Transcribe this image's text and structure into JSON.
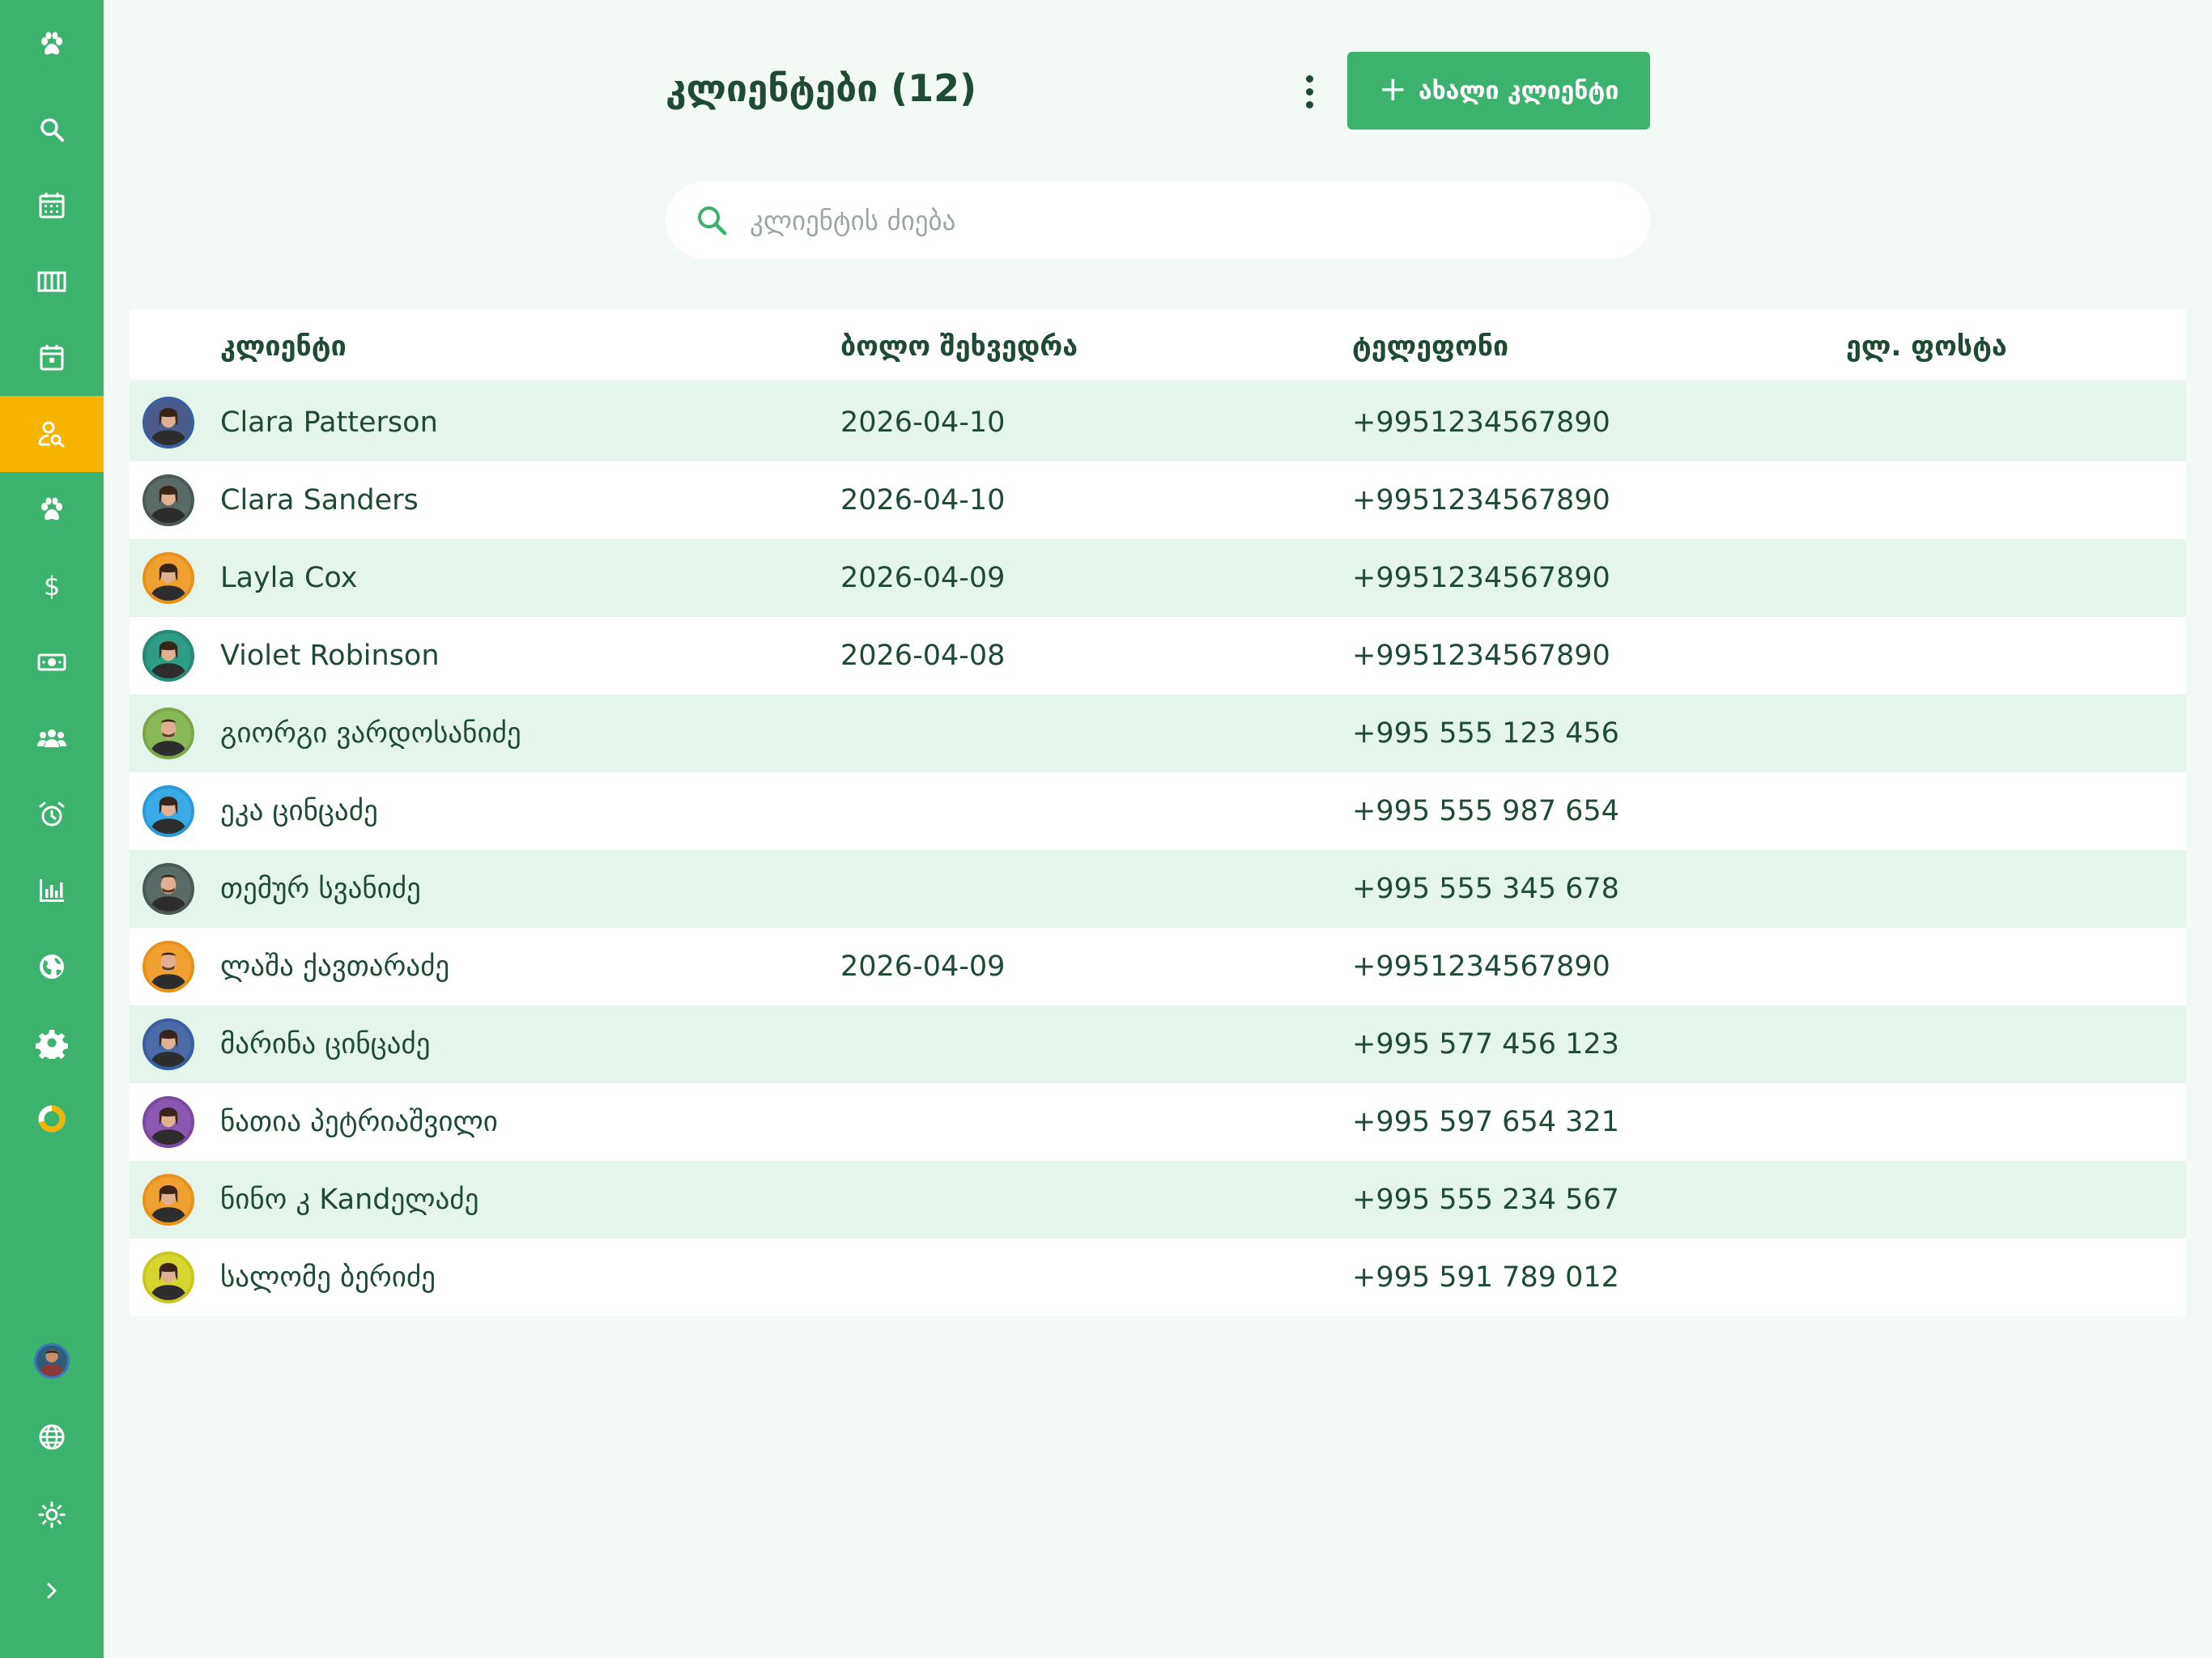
{
  "sidebar": {
    "items": [
      {
        "icon": "paw-icon",
        "active": false
      },
      {
        "icon": "search-icon",
        "active": false
      },
      {
        "icon": "calendar-icon",
        "active": false
      },
      {
        "icon": "columns-icon",
        "active": false
      },
      {
        "icon": "calendar-day-icon",
        "active": false
      },
      {
        "icon": "user-search-icon",
        "active": true
      },
      {
        "icon": "paw-icon",
        "active": false
      },
      {
        "icon": "dollar-icon",
        "active": false
      },
      {
        "icon": "money-bill-icon",
        "active": false
      },
      {
        "icon": "users-icon",
        "active": false
      },
      {
        "icon": "alarm-icon",
        "active": false
      },
      {
        "icon": "chart-bar-icon",
        "active": false
      },
      {
        "icon": "globe-filled-icon",
        "active": false
      },
      {
        "icon": "gear-icon",
        "active": false
      },
      {
        "icon": "donut-icon",
        "active": false
      }
    ],
    "bottom": [
      "user-avatar",
      "globe-icon",
      "sun-icon",
      "chevron-right-icon"
    ],
    "colors": {
      "background": "#3db26f",
      "active": "#f6b400"
    }
  },
  "header": {
    "title": "კლიენტები (12)",
    "new_button_label": "ახალი კლიენტი",
    "new_button_icon": "plus-icon",
    "menu_icon": "kebab-menu-icon"
  },
  "search": {
    "placeholder": "კლიენტის ძიება",
    "value": ""
  },
  "table": {
    "columns": [
      "კლიენტი",
      "ბოლო შეხვედრა",
      "ტელეფონი",
      "ელ. ფოსტა"
    ],
    "rows": [
      {
        "name": "Clara Patterson",
        "last_meeting": "2026-04-10",
        "phone": "+9951234567890",
        "email": "",
        "avatar_ring": "#3a5f9e",
        "avatar_bg": "#4a5a8a",
        "gender": "f"
      },
      {
        "name": "Clara Sanders",
        "last_meeting": "2026-04-10",
        "phone": "+9951234567890",
        "email": "",
        "avatar_ring": "#4a5a58",
        "avatar_bg": "#5a6a66",
        "gender": "f"
      },
      {
        "name": "Layla Cox",
        "last_meeting": "2026-04-09",
        "phone": "+9951234567890",
        "email": "",
        "avatar_ring": "#e8921c",
        "avatar_bg": "#f0a030",
        "gender": "f"
      },
      {
        "name": "Violet Robinson",
        "last_meeting": "2026-04-08",
        "phone": "+9951234567890",
        "email": "",
        "avatar_ring": "#2a8a78",
        "avatar_bg": "#2f9c86",
        "gender": "f"
      },
      {
        "name": "გიორგი ვარდოსანიძე",
        "last_meeting": "",
        "phone": "+995 555 123 456",
        "email": "",
        "avatar_ring": "#7aa84a",
        "avatar_bg": "#88b858",
        "gender": "m"
      },
      {
        "name": "ეკა ცინცაძე",
        "last_meeting": "",
        "phone": "+995 555 987 654",
        "email": "",
        "avatar_ring": "#2a9ad8",
        "avatar_bg": "#38aae6",
        "gender": "f"
      },
      {
        "name": "თემურ სვანიძე",
        "last_meeting": "",
        "phone": "+995 555 345 678",
        "email": "",
        "avatar_ring": "#4a5a58",
        "avatar_bg": "#5a6a66",
        "gender": "m"
      },
      {
        "name": "ლაშა ქავთარაძე",
        "last_meeting": "2026-04-09",
        "phone": "+9951234567890",
        "email": "",
        "avatar_ring": "#e8921c",
        "avatar_bg": "#f0a030",
        "gender": "m"
      },
      {
        "name": "მარინა ცინცაძე",
        "last_meeting": "",
        "phone": "+995 577 456 123",
        "email": "",
        "avatar_ring": "#3a5f9e",
        "avatar_bg": "#4a6aa8",
        "gender": "f"
      },
      {
        "name": "ნათია პეტრიაშვილი",
        "last_meeting": "",
        "phone": "+995 597 654 321",
        "email": "",
        "avatar_ring": "#7a4aa0",
        "avatar_bg": "#8a58b0",
        "gender": "f"
      },
      {
        "name": "ნინო კ Kandელაძე",
        "last_meeting": "",
        "phone": "+995 555 234 567",
        "email": "",
        "avatar_ring": "#e8921c",
        "avatar_bg": "#f0a030",
        "gender": "f"
      },
      {
        "name": "სალომე ბერიძე",
        "last_meeting": "",
        "phone": "+995 591 789 012",
        "email": "",
        "avatar_ring": "#c8c820",
        "avatar_bg": "#d6d630",
        "gender": "f"
      }
    ]
  }
}
